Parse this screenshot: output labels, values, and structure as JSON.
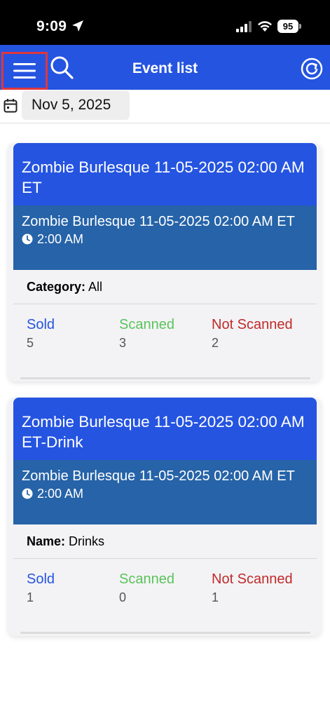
{
  "status_bar": {
    "time": "9:09",
    "battery": "95"
  },
  "header": {
    "title": "Event list"
  },
  "date_bar": {
    "date": "Nov 5, 2025"
  },
  "cards": [
    {
      "title": "Zombie Burlesque 11-05-2025 02:00 AM ET",
      "sub_name": "Zombie Burlesque 11-05-2025 02:00 AM ET",
      "sub_time": "2:00 AM",
      "meta_key": "Category",
      "meta_value": "All",
      "sold_label": "Sold",
      "sold_value": "5",
      "scanned_label": "Scanned",
      "scanned_value": "3",
      "not_scanned_label": "Not Scanned",
      "not_scanned_value": "2"
    },
    {
      "title": "Zombie Burlesque 11-05-2025 02:00 AM ET-Drink",
      "sub_name": "Zombie Burlesque 11-05-2025 02:00 AM ET",
      "sub_time": "2:00 AM",
      "meta_key": "Name",
      "meta_value": "Drinks",
      "sold_label": "Sold",
      "sold_value": "1",
      "scanned_label": "Scanned",
      "scanned_value": "0",
      "not_scanned_label": "Not Scanned",
      "not_scanned_value": "1"
    }
  ],
  "colors": {
    "header_blue": "#2554e0",
    "sub_blue": "#2663a8",
    "sold": "#2554e0",
    "scanned": "#5ac35b",
    "not_scanned": "#c02a2a",
    "highlight_box": "#e0373d"
  },
  "icons": [
    "location-arrow-icon",
    "signal-icon",
    "wifi-icon",
    "battery-icon",
    "menu-icon",
    "search-icon",
    "refresh-icon",
    "calendar-icon",
    "clock-icon"
  ]
}
